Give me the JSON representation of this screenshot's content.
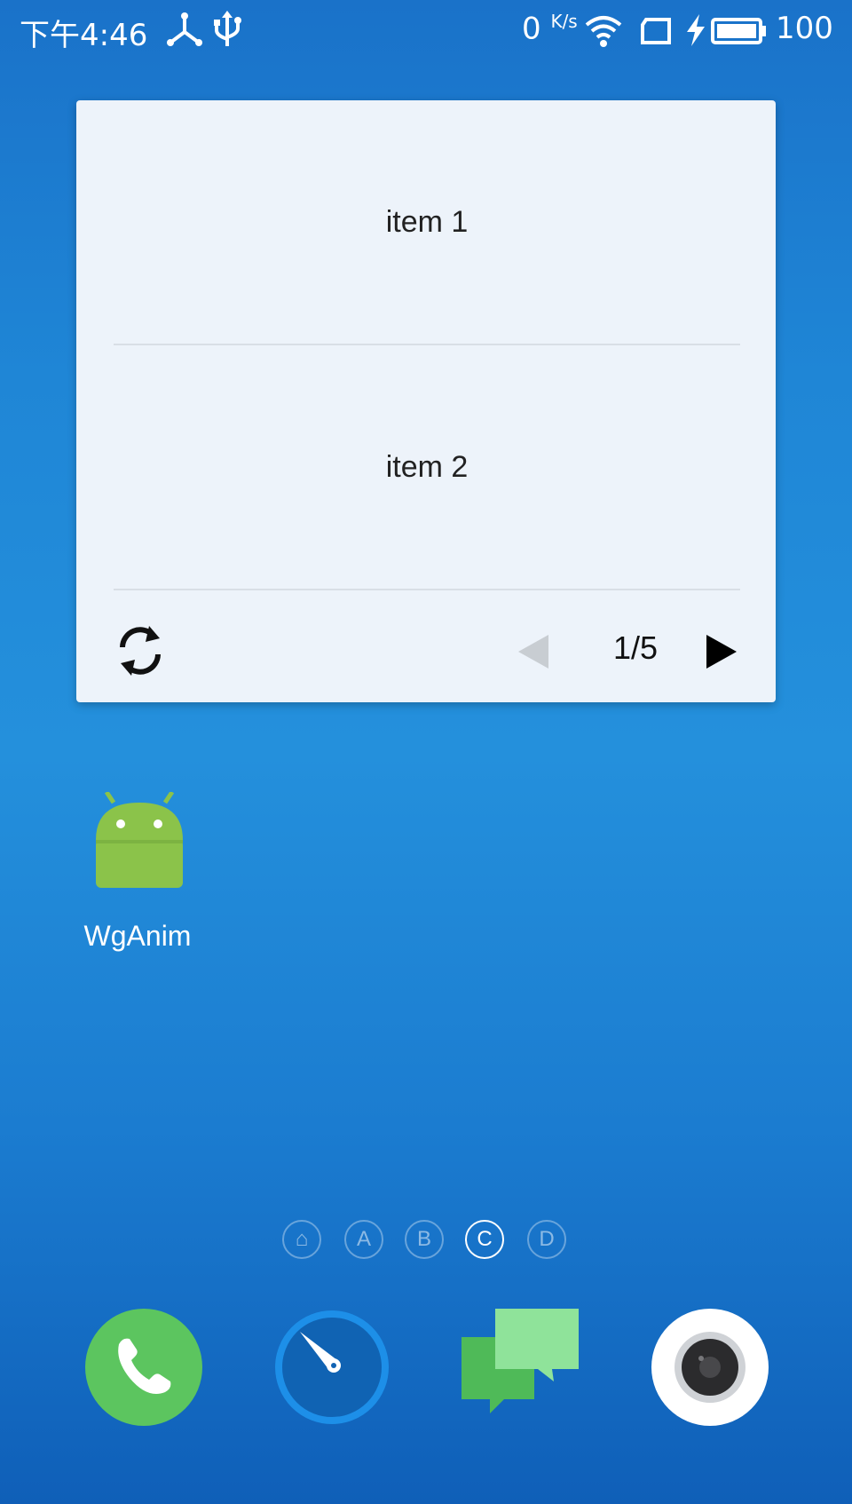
{
  "status_bar": {
    "time": "下午4:46",
    "net_speed_value": "0",
    "net_speed_unit": "K/s",
    "battery": "100",
    "icons": [
      "share-icon",
      "usb-icon",
      "wifi-icon",
      "sim-icon",
      "charging-icon",
      "battery-icon"
    ]
  },
  "widget": {
    "items": [
      "item 1",
      "item 2"
    ],
    "pager": "1/5",
    "icons": [
      "refresh-icon",
      "prev-arrow-icon",
      "next-arrow-icon"
    ],
    "colors": {
      "background": "#edf3fa",
      "prev_disabled": "#c8cdd2",
      "next": "#000000"
    }
  },
  "desktop": {
    "app_label": "WgAnim",
    "page_indicators": [
      "⌂",
      "A",
      "B",
      "C",
      "D"
    ],
    "active_page": "C"
  },
  "dock": {
    "icons": [
      "phone-icon",
      "browser-compass-icon",
      "messages-icon",
      "camera-icon"
    ],
    "colors": {
      "phone": "#5cc55f",
      "browser": "#1d8fe8",
      "messages": "#6fd37a",
      "camera": "#ffffff"
    }
  }
}
